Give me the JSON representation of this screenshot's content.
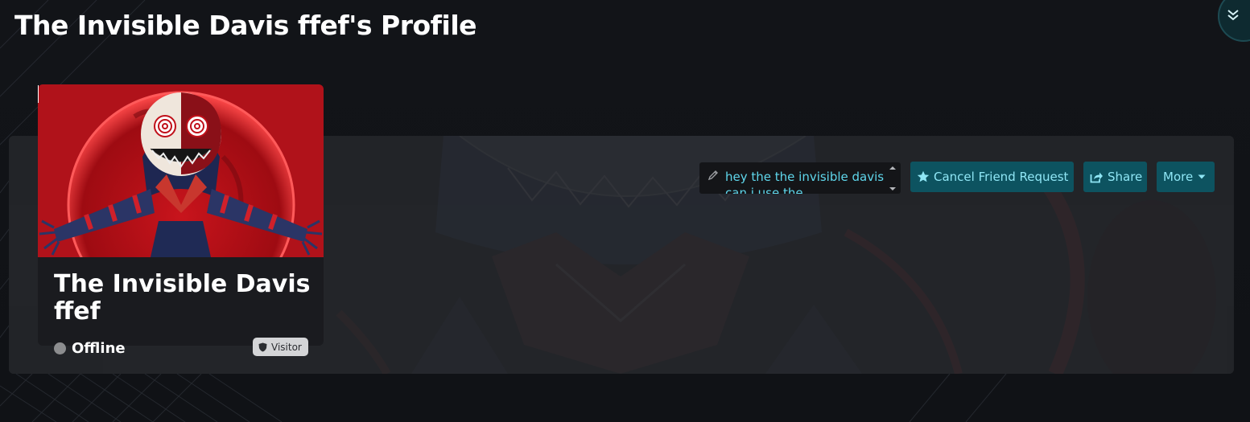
{
  "page": {
    "title": "The Invisible Davis ffef's Profile"
  },
  "profile": {
    "display_name": "The Invisible Davis ffef",
    "status": "Offline",
    "status_color": "#8c8d8f",
    "badge": "Visitor",
    "badge_icon": "shield-icon"
  },
  "note": {
    "icon": "pencil-icon",
    "text": "hey the the invisible davis can i use the"
  },
  "actions": {
    "cancel_friend_request": "Cancel Friend Request",
    "cancel_icon": "star-icon",
    "share": "Share",
    "share_icon": "share-icon",
    "more": "More",
    "more_icon": "caret-down-icon"
  },
  "colors": {
    "accent_button_bg": "#0d5360",
    "accent_text": "#8fe6f5",
    "note_text": "#5fd7ec",
    "panel_bg": "#232529",
    "page_bg": "#111317"
  }
}
